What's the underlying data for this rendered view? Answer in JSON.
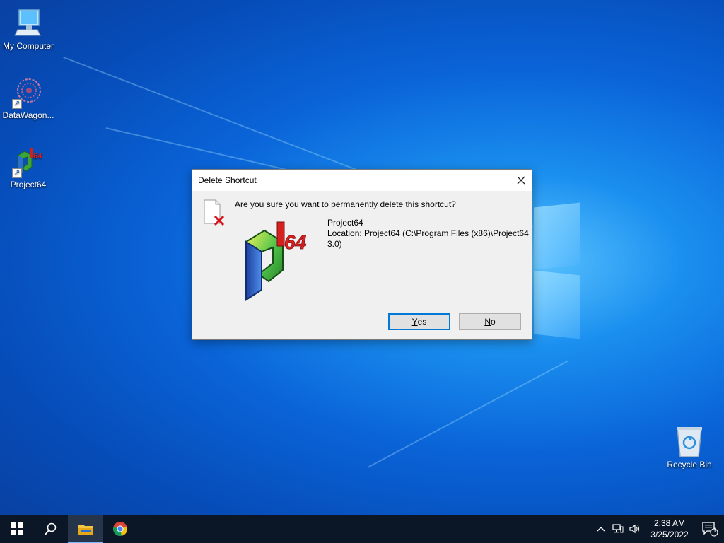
{
  "desktop": {
    "icons": [
      {
        "label": "My Computer"
      },
      {
        "label": "DataWagon..."
      },
      {
        "label": "Project64"
      },
      {
        "label": "Recycle Bin"
      }
    ]
  },
  "dialog": {
    "title": "Delete Shortcut",
    "question": "Are you sure you want to permanently delete this shortcut?",
    "item_name": "Project64",
    "location": "Location: Project64 (C:\\Program Files (x86)\\Project64 3.0)",
    "buttons": {
      "yes": {
        "mnemonic": "Y",
        "rest": "es"
      },
      "no": {
        "mnemonic": "N",
        "rest": "o"
      }
    }
  },
  "taskbar": {
    "clock": {
      "time": "2:38 AM",
      "date": "3/25/2022"
    },
    "notification_count": "1"
  },
  "colors": {
    "accent": "#0078d7",
    "taskbar": "#0b1626",
    "dialog_bg": "#f0f0f0"
  }
}
